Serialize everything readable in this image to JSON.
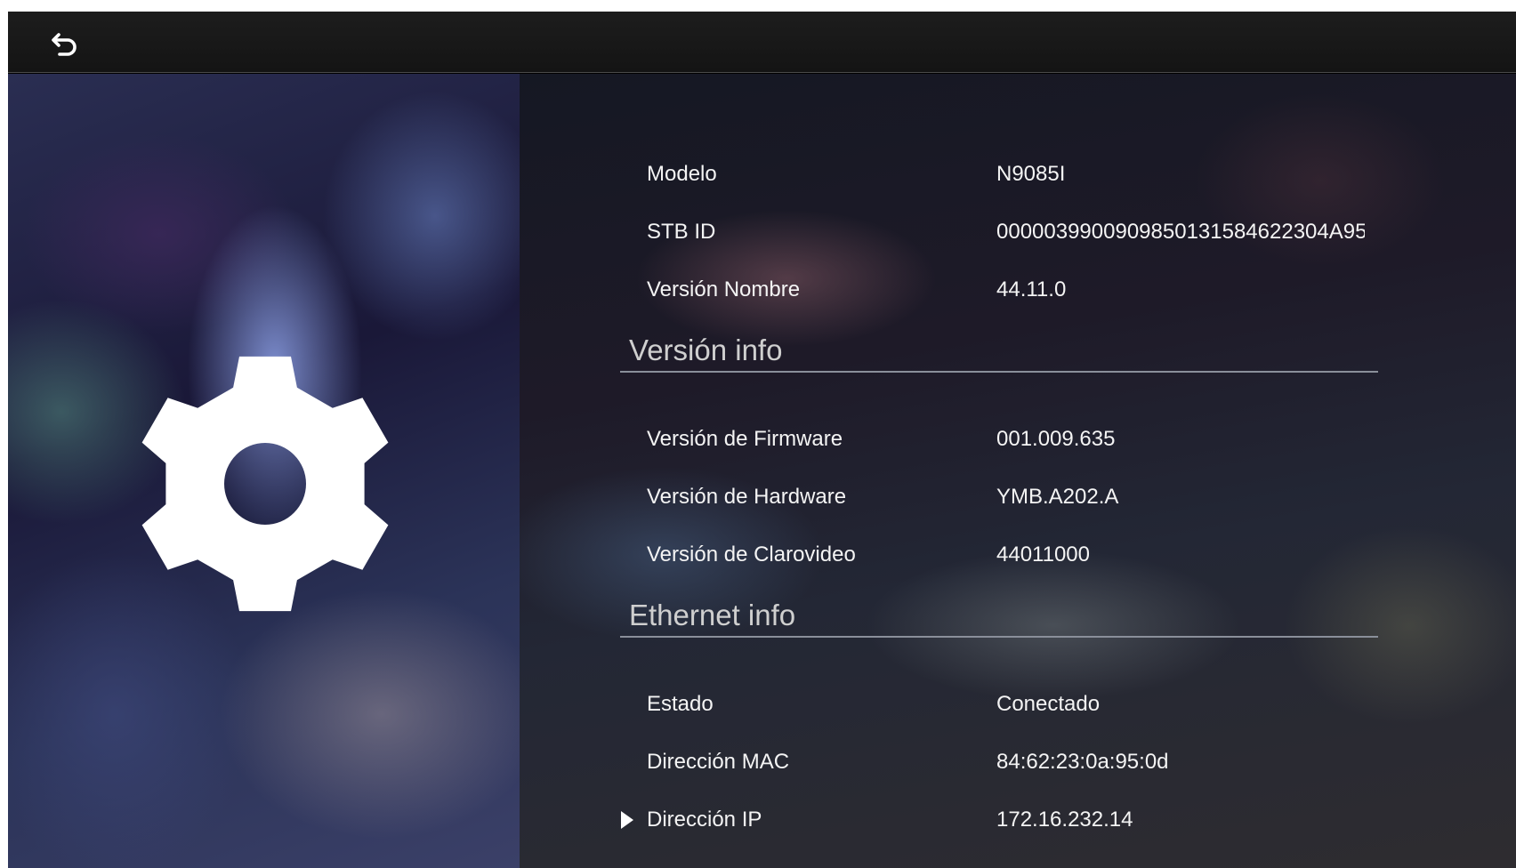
{
  "header": {
    "back_icon": "back-arrow-icon"
  },
  "left": {
    "icon": "gear-icon",
    "icon_color": "#ffffff"
  },
  "device_info": [
    {
      "label": "Modelo",
      "value": "N9085I"
    },
    {
      "label": "STB ID",
      "value": "0000039900909850131584622304A95("
    },
    {
      "label": "Versión Nombre",
      "value": "44.11.0"
    }
  ],
  "version_section": {
    "title": "Versión info",
    "items": [
      {
        "label": "Versión de Firmware",
        "value": "001.009.635"
      },
      {
        "label": "Versión de Hardware",
        "value": "YMB.A202.A"
      },
      {
        "label": "Versión de Clarovideo",
        "value": "44011000"
      }
    ]
  },
  "ethernet_section": {
    "title": "Ethernet info",
    "items": [
      {
        "label": "Estado",
        "value": "Conectado"
      },
      {
        "label": "Dirección MAC",
        "value": "84:62:23:0a:95:0d"
      },
      {
        "label": "Dirección IP",
        "value": "172.16.232.14"
      }
    ]
  },
  "focused_item": "Dirección IP"
}
